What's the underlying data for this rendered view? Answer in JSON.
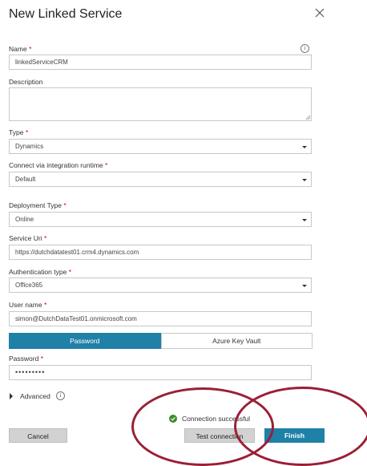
{
  "dialog": {
    "title": "New Linked Service"
  },
  "form": {
    "name_label": "Name",
    "name_value": "linkedServiceCRM",
    "description_label": "Description",
    "description_value": "",
    "type_label": "Type",
    "type_value": "Dynamics",
    "runtime_label": "Connect via integration runtime",
    "runtime_value": "Default",
    "deployment_label": "Deployment Type",
    "deployment_value": "Online",
    "service_uri_label": "Service Uri",
    "service_uri_value": "https://dutchdatatest01.crm4.dynamics.com",
    "auth_label": "Authentication type",
    "auth_value": "Office365",
    "username_label": "User name",
    "username_value": "simon@DutchDataTest01.onmicrosoft.com",
    "tabs": [
      "Password",
      "Azure Key Vault"
    ],
    "password_label": "Password",
    "password_value": "•••••••••",
    "advanced_label": "Advanced",
    "required_mark": "*"
  },
  "status": {
    "text": "Connection successful"
  },
  "buttons": {
    "cancel": "Cancel",
    "test": "Test connection",
    "finish": "Finish"
  },
  "colors": {
    "accent": "#1f80a8",
    "required": "#d0021b",
    "success": "#3f8a2e",
    "annotation": "#9b1f36"
  },
  "icons": {
    "close": "close-icon",
    "info": "info-icon",
    "chevron": "chevron-right-icon",
    "success": "check-circle-icon"
  }
}
